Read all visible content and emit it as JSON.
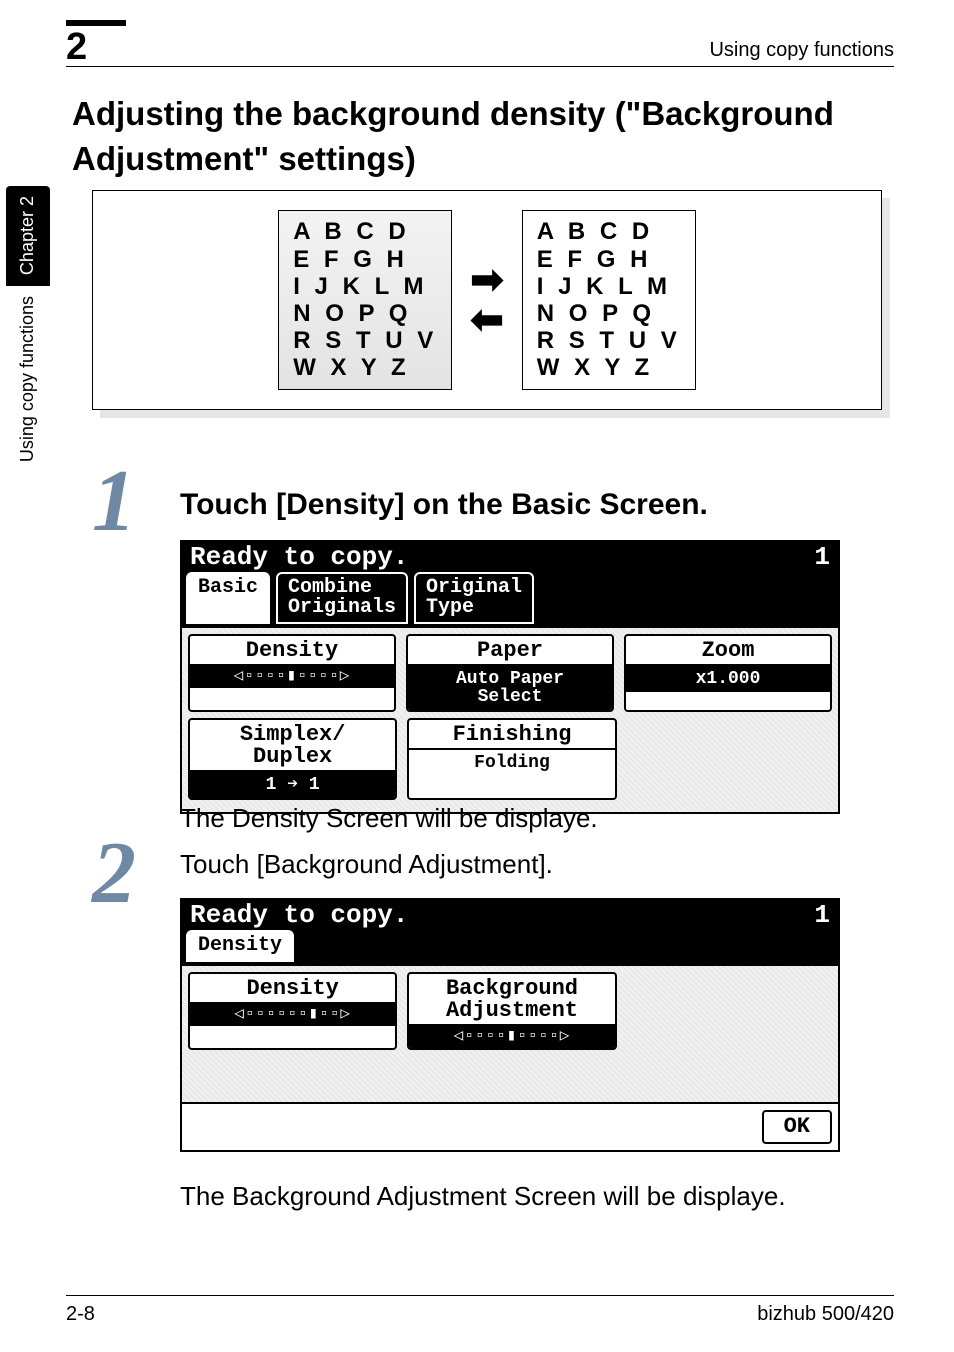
{
  "header": {
    "chapter_number": "2",
    "breadcrumb": "Using copy functions"
  },
  "sidetab": {
    "chapter_label": "Chapter 2",
    "section_label": "Using copy functions"
  },
  "heading": "Adjusting the background density (\"Background Adjustment\" settings)",
  "illustration": {
    "rows": [
      "A B C D",
      "E F G H",
      "I J K L M",
      "N O P Q",
      "R S T U V",
      "W X Y Z"
    ]
  },
  "step1": {
    "number": "1",
    "title": "Touch [Density] on the Basic Screen.",
    "caption": "The Density Screen will be displaye."
  },
  "lcd1": {
    "status": "Ready to copy.",
    "count": "1",
    "tabs": {
      "basic": "Basic",
      "combine": "Combine\nOriginals",
      "orig": "Original\nType"
    },
    "cells": {
      "density_label": "Density",
      "density_bars": "◁▫▫▫▫▮▫▫▫▫▷",
      "paper_label": "Paper",
      "paper_value": "Auto Paper\nSelect",
      "zoom_label": "Zoom",
      "zoom_value": "x1.000",
      "duplex_label": "Simplex/\nDuplex",
      "duplex_value": "1 ➔ 1",
      "finishing_label": "Finishing",
      "folding_label": "Folding"
    }
  },
  "step2": {
    "number": "2",
    "title": "Touch [Background Adjustment].",
    "caption": "The Background Adjustment Screen will be displaye."
  },
  "lcd2": {
    "status": "Ready to copy.",
    "count": "1",
    "tab": "Density",
    "cells": {
      "density_label": "Density",
      "density_bars": "◁▫▫▫▫▫▫▮▫▫▷",
      "bg_label": "Background\nAdjustment",
      "bg_bars": "◁▫▫▫▫▮▫▫▫▫▷"
    },
    "ok": "OK"
  },
  "footer": {
    "page": "2-8",
    "model": "bizhub 500/420"
  }
}
